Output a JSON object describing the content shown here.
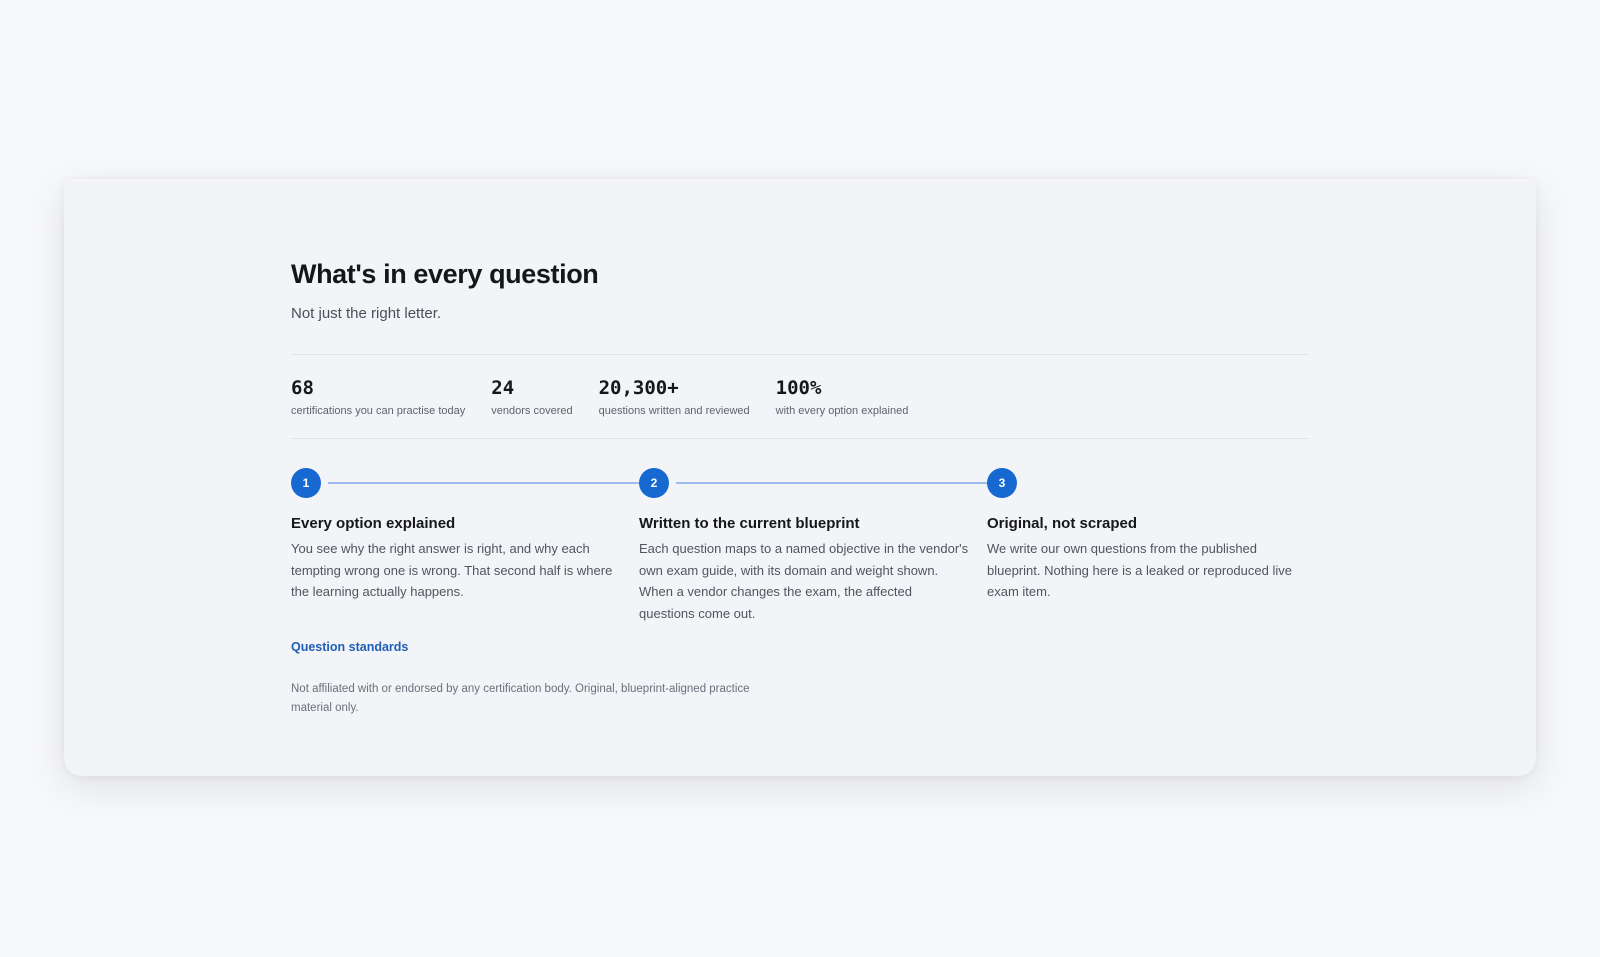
{
  "section": {
    "title": "What's in every question",
    "subtitle": "Not just the right letter."
  },
  "stats": [
    {
      "value": "68",
      "label": "certifications you can practise today"
    },
    {
      "value": "24",
      "label": "vendors covered"
    },
    {
      "value": "20,300+",
      "label": "questions written and reviewed"
    },
    {
      "value": "100%",
      "label": "with every option explained"
    }
  ],
  "steps": [
    {
      "number": "1",
      "title": "Every option explained",
      "description": "You see why the right answer is right, and why each tempting wrong one is wrong. That second half is where the learning actually happens."
    },
    {
      "number": "2",
      "title": "Written to the current blueprint",
      "description": "Each question maps to a named objective in the vendor's own exam guide, with its domain and weight shown. When a vendor changes the exam, the affected questions come out."
    },
    {
      "number": "3",
      "title": "Original, not scraped",
      "description": "We write our own questions from the published blueprint. Nothing here is a leaked or reproduced live exam item."
    }
  ],
  "footer": {
    "link_label": "Question standards",
    "disclaimer": "Not affiliated with or endorsed by any certification body. Original, blueprint-aligned practice material only."
  },
  "colors": {
    "accent": "#1769d2",
    "connector": "#9cbcf0",
    "link": "#1f5fb6",
    "card_background": "#f3f4f7",
    "page_background": "#f7f8fa"
  }
}
